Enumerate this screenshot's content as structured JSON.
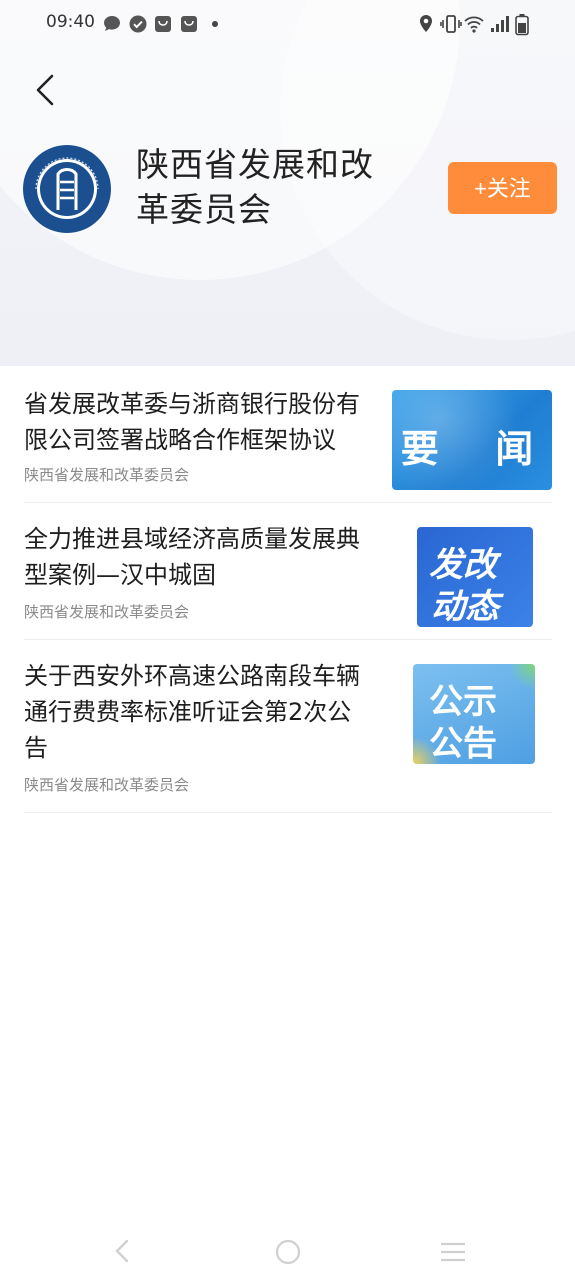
{
  "status_bar": {
    "time": "09:40",
    "left_icons": [
      "message-icon",
      "check-circle-icon",
      "bag-icon",
      "bag-icon"
    ],
    "right_icons": [
      "location-icon",
      "vibrate-icon",
      "wifi-icon",
      "signal-icon",
      "battery-icon"
    ]
  },
  "header": {
    "back_icon": "chevron-left-icon",
    "org_name_line1": "陕西省发展和改",
    "org_name_line2": "革委员会",
    "follow_label": "+关注",
    "logo_text": "陕西省发展和改革委员会",
    "colors": {
      "follow": "#ff8c3b",
      "logo": "#1b4f8f"
    }
  },
  "news": [
    {
      "title": "省发展改革委与浙商银行股份有限公司签署战略合作框架协议",
      "source": "陕西省发展和改革委员会",
      "thumb_text": "要  闻",
      "thumb_color": "#2a8fd8"
    },
    {
      "title": "全力推进县域经济高质量发展典型案例—汉中城固",
      "source": "陕西省发展和改革委员会",
      "thumb_text_line1": "发改",
      "thumb_text_line2": "动态",
      "thumb_color": "#2f6fd6"
    },
    {
      "title": "关于西安外环高速公路南段车辆通行费费率标准听证会第2次公告",
      "source": "陕西省发展和改革委员会",
      "thumb_text_line1": "公示",
      "thumb_text_line2": "公告",
      "thumb_color": "#5aa6e6"
    }
  ],
  "nav_bar": {
    "icons": [
      "nav-back-icon",
      "nav-home-icon",
      "nav-menu-icon"
    ]
  }
}
